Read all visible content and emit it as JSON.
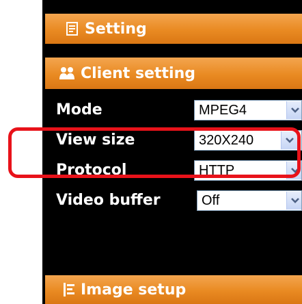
{
  "headers": {
    "setting": {
      "label": "Setting",
      "icon": "notepad-icon"
    },
    "client_setting": {
      "label": "Client setting",
      "icon": "users-icon"
    },
    "image_setup": {
      "label": "Image setup",
      "icon": "image-setup-icon"
    }
  },
  "client_settings": [
    {
      "label": "Mode",
      "value": "MPEG4"
    },
    {
      "label": "View size",
      "value": "320X240"
    },
    {
      "label": "Protocol",
      "value": "HTTP"
    },
    {
      "label": "Video buffer",
      "value": "Off"
    }
  ],
  "colors": {
    "header_orange": "#e98a22",
    "panel_background": "#000000",
    "highlight": "#e8121a",
    "dropdown_arrow": "#4d6185"
  }
}
